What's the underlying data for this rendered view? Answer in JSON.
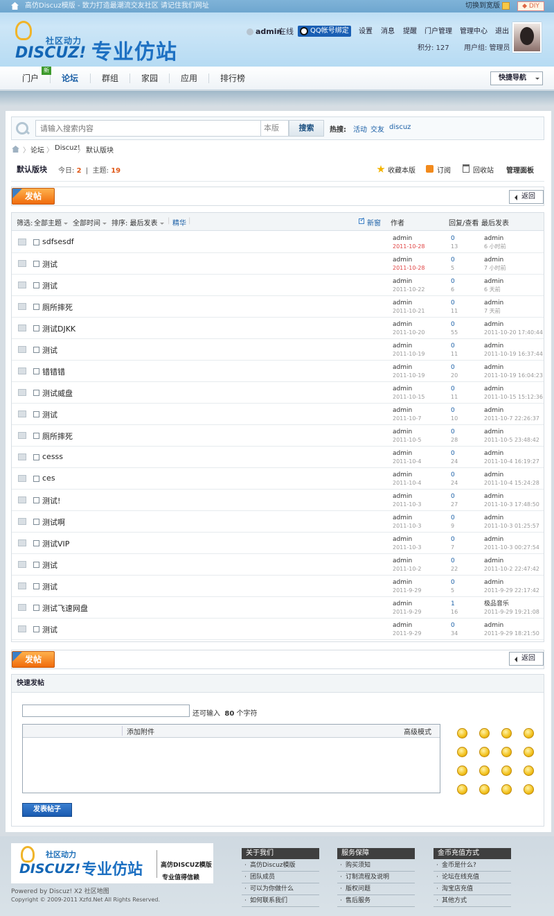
{
  "topbar": {
    "slogan": "高仿Discuz模版 - 致力打造最潮流交友社区  请记住我们网址",
    "switch_label": "切换到宽版",
    "diy_label": "◆ DIY"
  },
  "logo": {
    "small": "社区动力",
    "disc": "DISCUZ!",
    "big": "专业仿站"
  },
  "user": {
    "name": "admin",
    "status": "在线",
    "qq_bind": "QQ帐号绑定",
    "menu": [
      "设置",
      "消息",
      "提醒",
      "门户管理",
      "管理中心",
      "退出"
    ],
    "credits": "积分: 127",
    "group": "用户组: 管理员"
  },
  "nav": {
    "items": [
      "门户",
      "论坛",
      "群组",
      "家园",
      "应用",
      "排行榜"
    ],
    "new_badge": "新",
    "quick_nav": "快捷导航"
  },
  "search": {
    "placeholder": "请输入搜索内容",
    "scope": "本版",
    "button": "搜索",
    "hot_label": "热搜:",
    "hot_links": [
      "活动",
      "交友",
      "discuz"
    ]
  },
  "breadcrumb": [
    "论坛",
    "Discuz!",
    "默认版块"
  ],
  "forum": {
    "title": "默认版块",
    "today_label": "今日:",
    "today": "2",
    "topics_label": "主题:",
    "topics": "19",
    "favorite": "收藏本版",
    "subscribe": "订阅",
    "recycle": "回收站",
    "admin_panel": "管理面板"
  },
  "post_button": "发帖",
  "back_button": "返回",
  "thread_head": {
    "filter": "筛选:",
    "all_topics": "全部主题",
    "all_time": "全部时间",
    "sort": "排序: 最后发表",
    "digest": "精华",
    "new_window": "新窗",
    "author": "作者",
    "reply_view": "回复/查看",
    "last_post": "最后发表"
  },
  "threads": [
    {
      "title": "sdfsesdf",
      "author": "admin",
      "date": "2011-10-28",
      "replies": "0",
      "views": "13",
      "last_user": "admin",
      "last_time": "6 小时前",
      "new": true
    },
    {
      "title": "测试",
      "author": "admin",
      "date": "2011-10-28",
      "replies": "0",
      "views": "5",
      "last_user": "admin",
      "last_time": "7 小时前",
      "new": true
    },
    {
      "title": "测试",
      "author": "admin",
      "date": "2011-10-22",
      "replies": "0",
      "views": "6",
      "last_user": "admin",
      "last_time": "6 天前",
      "new": false
    },
    {
      "title": "厕所摔死",
      "author": "admin",
      "date": "2011-10-21",
      "replies": "0",
      "views": "11",
      "last_user": "admin",
      "last_time": "7 天前",
      "new": false
    },
    {
      "title": "测试DJKK",
      "author": "admin",
      "date": "2011-10-20",
      "replies": "0",
      "views": "55",
      "last_user": "admin",
      "last_time": "2011-10-20 17:40:44",
      "new": false
    },
    {
      "title": "测试",
      "author": "admin",
      "date": "2011-10-19",
      "replies": "0",
      "views": "11",
      "last_user": "admin",
      "last_time": "2011-10-19 16:37:44",
      "new": false
    },
    {
      "title": "错错错",
      "author": "admin",
      "date": "2011-10-19",
      "replies": "0",
      "views": "20",
      "last_user": "admin",
      "last_time": "2011-10-19 16:04:23",
      "new": false
    },
    {
      "title": "测试威盘",
      "author": "admin",
      "date": "2011-10-15",
      "replies": "0",
      "views": "11",
      "last_user": "admin",
      "last_time": "2011-10-15 15:12:36",
      "new": false
    },
    {
      "title": "测试",
      "author": "admin",
      "date": "2011-10-7",
      "replies": "0",
      "views": "10",
      "last_user": "admin",
      "last_time": "2011-10-7 22:26:37",
      "new": false
    },
    {
      "title": "厕所摔死",
      "author": "admin",
      "date": "2011-10-5",
      "replies": "0",
      "views": "28",
      "last_user": "admin",
      "last_time": "2011-10-5 23:48:42",
      "new": false
    },
    {
      "title": "cesss",
      "author": "admin",
      "date": "2011-10-4",
      "replies": "0",
      "views": "24",
      "last_user": "admin",
      "last_time": "2011-10-4 16:19:27",
      "new": false
    },
    {
      "title": "ces",
      "author": "admin",
      "date": "2011-10-4",
      "replies": "0",
      "views": "24",
      "last_user": "admin",
      "last_time": "2011-10-4 15:24:28",
      "new": false
    },
    {
      "title": "测试!",
      "author": "admin",
      "date": "2011-10-3",
      "replies": "0",
      "views": "27",
      "last_user": "admin",
      "last_time": "2011-10-3 17:48:50",
      "new": false
    },
    {
      "title": "测试啊",
      "author": "admin",
      "date": "2011-10-3",
      "replies": "0",
      "views": "9",
      "last_user": "admin",
      "last_time": "2011-10-3 01:25:57",
      "new": false
    },
    {
      "title": "测试VIP",
      "author": "admin",
      "date": "2011-10-3",
      "replies": "0",
      "views": "7",
      "last_user": "admin",
      "last_time": "2011-10-3 00:27:54",
      "new": false
    },
    {
      "title": "测试",
      "author": "admin",
      "date": "2011-10-2",
      "replies": "0",
      "views": "22",
      "last_user": "admin",
      "last_time": "2011-10-2 22:47:42",
      "new": false
    },
    {
      "title": "测试",
      "author": "admin",
      "date": "2011-9-29",
      "replies": "0",
      "views": "5",
      "last_user": "admin",
      "last_time": "2011-9-29 22:17:42",
      "new": false
    },
    {
      "title": "测试飞速网盘",
      "author": "admin",
      "date": "2011-9-29",
      "replies": "1",
      "views": "16",
      "last_user": "极品音乐",
      "last_time": "2011-9-29 19:21:08",
      "new": false
    },
    {
      "title": "测试",
      "author": "admin",
      "date": "2011-9-29",
      "replies": "0",
      "views": "34",
      "last_user": "admin",
      "last_time": "2011-9-29 18:21:50",
      "new": false
    }
  ],
  "quick_post": {
    "title": "快速发帖",
    "remain_prefix": "还可输入",
    "remain_count": "80",
    "remain_suffix": "个字符",
    "attach": "添加附件",
    "advanced": "高级模式",
    "submit": "发表帖子"
  },
  "footer": {
    "logo_small": "社区动力",
    "logo_disc": "DISCUZ!",
    "logo_big": "专业仿站",
    "tag1": "高仿DISCUZ模版",
    "tag2": "专业值得信赖",
    "powered": "Powered by Discuz! X2  社区地图",
    "copyright": "Copyright © 2009-2011 Xzfd.Net All Rights Reserved.",
    "columns": [
      {
        "title": "关于我们",
        "links": [
          "高仿Discuz模版",
          "团队成员",
          "可以为你做什么",
          "如何联系我们"
        ]
      },
      {
        "title": "服务保障",
        "links": [
          "购买须知",
          "订制流程及说明",
          "版权问题",
          "售后服务"
        ]
      },
      {
        "title": "金币充值方式",
        "links": [
          "金币是什么?",
          "论坛在线充值",
          "淘宝店充值",
          "其他方式"
        ]
      }
    ]
  }
}
